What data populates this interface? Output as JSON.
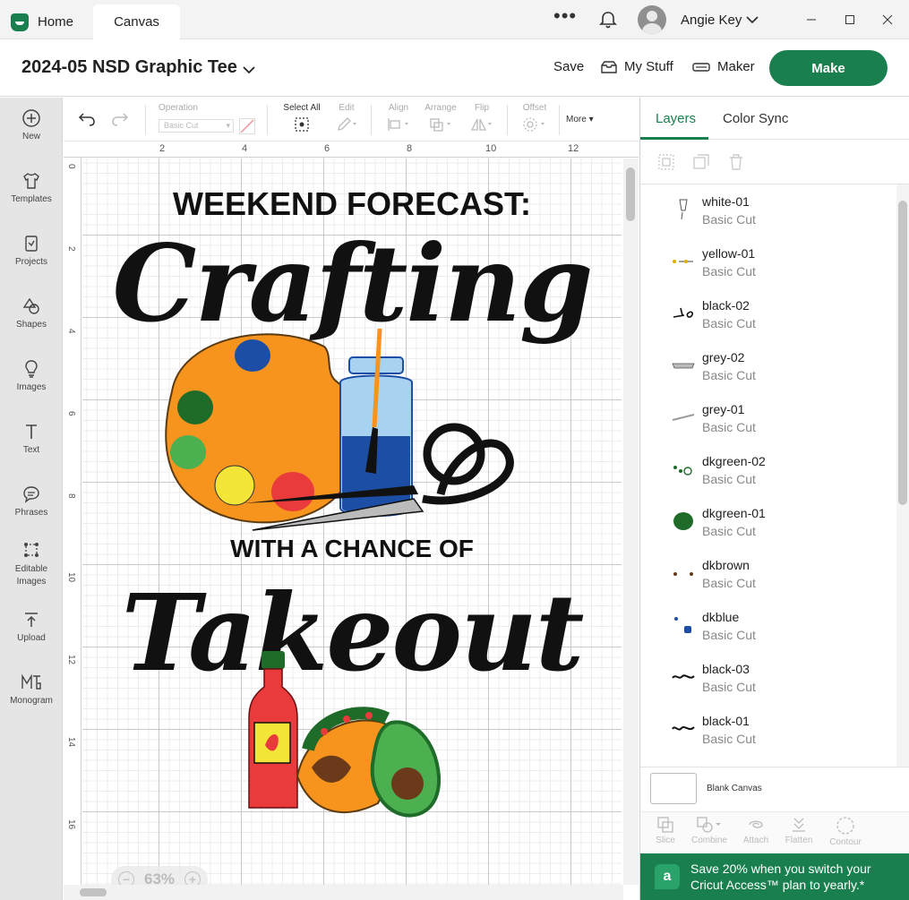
{
  "titlebar": {
    "home_tab": "Home",
    "canvas_tab": "Canvas",
    "more_dots": "•••",
    "user_name": "Angie Key"
  },
  "header": {
    "project_title": "2024-05 NSD Graphic Tee",
    "save": "Save",
    "my_stuff": "My Stuff",
    "maker": "Maker",
    "make": "Make"
  },
  "left_toolbar": [
    {
      "label": "New",
      "icon": "plus-circle-icon"
    },
    {
      "label": "Templates",
      "icon": "tshirt-icon"
    },
    {
      "label": "Projects",
      "icon": "projects-icon"
    },
    {
      "label": "Shapes",
      "icon": "shapes-icon"
    },
    {
      "label": "Images",
      "icon": "lightbulb-icon"
    },
    {
      "label": "Text",
      "icon": "text-icon"
    },
    {
      "label": "Phrases",
      "icon": "speech-bubble-icon"
    },
    {
      "label": "Editable Images",
      "icon": "editable-images-icon"
    },
    {
      "label": "Upload",
      "icon": "upload-icon"
    },
    {
      "label": "Monogram",
      "icon": "monogram-icon"
    }
  ],
  "edit_toolbar": {
    "operation_label": "Operation",
    "operation_value": "Basic Cut",
    "select_all": "Select All",
    "edit": "Edit",
    "align": "Align",
    "arrange": "Arrange",
    "flip": "Flip",
    "offset": "Offset",
    "more": "More"
  },
  "rulers": {
    "top": [
      "2",
      "4",
      "6",
      "8",
      "10",
      "12"
    ],
    "left": [
      "0",
      "2",
      "4",
      "6",
      "8",
      "10",
      "12",
      "14",
      "16"
    ]
  },
  "canvas": {
    "zoom": "63%",
    "design": {
      "line1": "WEEKEND FORECAST:",
      "line2": "Crafting",
      "line3": "WITH A CHANCE OF",
      "line4": "Takeout"
    },
    "colors": {
      "orange": "#f7941d",
      "dkgreen": "#1f6b2a",
      "green": "#4caf50",
      "yellow": "#f4e636",
      "red": "#e93b3b",
      "blue": "#1d4ea6",
      "lightblue": "#a8d3f0",
      "black": "#111111"
    }
  },
  "right_panel": {
    "tab_layers": "Layers",
    "tab_color_sync": "Color Sync",
    "layers": [
      {
        "name": "white-01",
        "type": "Basic Cut"
      },
      {
        "name": "yellow-01",
        "type": "Basic Cut"
      },
      {
        "name": "black-02",
        "type": "Basic Cut"
      },
      {
        "name": "grey-02",
        "type": "Basic Cut"
      },
      {
        "name": "grey-01",
        "type": "Basic Cut"
      },
      {
        "name": "dkgreen-02",
        "type": "Basic Cut"
      },
      {
        "name": "dkgreen-01",
        "type": "Basic Cut"
      },
      {
        "name": "dkbrown",
        "type": "Basic Cut"
      },
      {
        "name": "dkblue",
        "type": "Basic Cut"
      },
      {
        "name": "black-03",
        "type": "Basic Cut"
      },
      {
        "name": "black-01",
        "type": "Basic Cut"
      }
    ],
    "blank_canvas": "Blank Canvas",
    "bottom_tools": [
      "Slice",
      "Combine",
      "Attach",
      "Flatten",
      "Contour"
    ],
    "promo_badge": "a",
    "promo_text": "Save 20% when you switch your Cricut Access™ plan to yearly.*"
  },
  "accent_color": "#1a7f4e"
}
